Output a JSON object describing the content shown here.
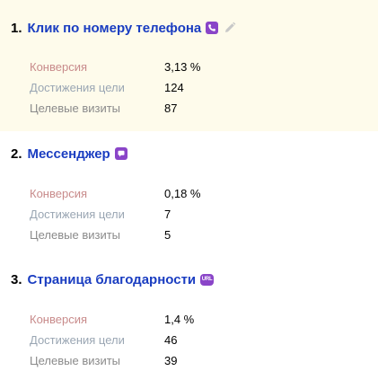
{
  "colors": {
    "goal_link": "#1a3dc1",
    "icon_accent": "#8a45c8",
    "highlight_bg": "#fefbeb",
    "conversion_label": "#c88b8b",
    "reaches_label": "#9aa6b3",
    "visits_label": "#8a8a8a"
  },
  "goals": [
    {
      "number": "1.",
      "name": "Клик по номеру телефона",
      "type_icon": "phone-icon",
      "editable": true,
      "highlighted": true,
      "metrics": {
        "conversion_label": "Конверсия",
        "conversion_value": "3,13 %",
        "reaches_label": "Достижения цели",
        "reaches_value": "124",
        "visits_label": "Целевые визиты",
        "visits_value": "87"
      }
    },
    {
      "number": "2.",
      "name": "Мессенджер",
      "type_icon": "chat-icon",
      "editable": false,
      "highlighted": false,
      "metrics": {
        "conversion_label": "Конверсия",
        "conversion_value": "0,18 %",
        "reaches_label": "Достижения цели",
        "reaches_value": "7",
        "visits_label": "Целевые визиты",
        "visits_value": "5"
      }
    },
    {
      "number": "3.",
      "name": "Страница благодарности",
      "type_icon": "url-icon",
      "type_icon_text": "URL",
      "editable": false,
      "highlighted": false,
      "metrics": {
        "conversion_label": "Конверсия",
        "conversion_value": "1,4 %",
        "reaches_label": "Достижения цели",
        "reaches_value": "46",
        "visits_label": "Целевые визиты",
        "visits_value": "39"
      }
    }
  ]
}
